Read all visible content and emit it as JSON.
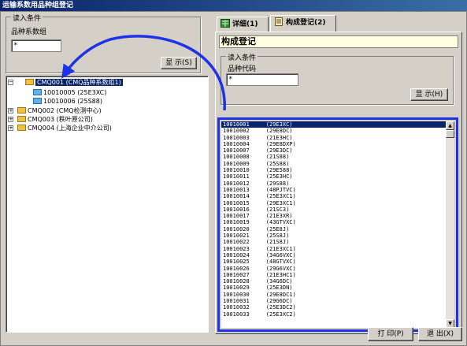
{
  "window": {
    "title": "运输系数用品种组登记"
  },
  "left": {
    "group_title": "读入条件",
    "field_label": "品种系数组",
    "field_value": "*",
    "show_button": "显 示(S)",
    "tree": [
      {
        "code": "CMQ001",
        "name": "(CMQ品种系数组1)",
        "selected": true,
        "expanded": true,
        "children": [
          {
            "code": "10010005",
            "name": "(25E3XC)"
          },
          {
            "code": "10010006",
            "name": "(25S88)"
          }
        ]
      },
      {
        "code": "CMQ002",
        "name": "(CMQ检测中心)"
      },
      {
        "code": "CMQ003",
        "name": "(秩叶原公司)"
      },
      {
        "code": "CMQ004",
        "name": "(上海企业中介公司)"
      }
    ]
  },
  "tabs": [
    {
      "label": "详细(1)",
      "icon": "book-icon"
    },
    {
      "label": "构成登记(2)",
      "icon": "notepad-icon"
    }
  ],
  "right": {
    "section_title": "构成登记",
    "group_title": "读入条件",
    "field_label": "品种代码",
    "field_value": "*",
    "show_button": "显 示(H)",
    "list": [
      {
        "code": "10010001",
        "name": "(29E3XC)"
      },
      {
        "code": "10010002",
        "name": "(29E8DC)"
      },
      {
        "code": "10010003",
        "name": "(21E3HC)"
      },
      {
        "code": "10010004",
        "name": "(29E8DXP)"
      },
      {
        "code": "10010007",
        "name": "(29E3DC)"
      },
      {
        "code": "10010008",
        "name": "(21S88)"
      },
      {
        "code": "10010009",
        "name": "(25S88)"
      },
      {
        "code": "10010010",
        "name": "(29E588)"
      },
      {
        "code": "10010011",
        "name": "(25E3HC)"
      },
      {
        "code": "10010012",
        "name": "(29S88)"
      },
      {
        "code": "10010013",
        "name": "(48PJTVC)"
      },
      {
        "code": "10010014",
        "name": "(25E3XC1)"
      },
      {
        "code": "10010015",
        "name": "(29E3XC1)"
      },
      {
        "code": "10010016",
        "name": "(21SC3)"
      },
      {
        "code": "10010017",
        "name": "(21E3XR)"
      },
      {
        "code": "10010019",
        "name": "(43GTVXC)"
      },
      {
        "code": "10010020",
        "name": "(25E8J)"
      },
      {
        "code": "10010021",
        "name": "(25S8J)"
      },
      {
        "code": "10010022",
        "name": "(21S8J)"
      },
      {
        "code": "10010023",
        "name": "(21E3XC1)"
      },
      {
        "code": "10010024",
        "name": "(34G6VXC)"
      },
      {
        "code": "10010025",
        "name": "(48GTVXC)"
      },
      {
        "code": "10010026",
        "name": "(29G6VXC)"
      },
      {
        "code": "10010027",
        "name": "(21E3HC1)"
      },
      {
        "code": "10010028",
        "name": "(34G6DC)"
      },
      {
        "code": "10010029",
        "name": "(25E3DN)"
      },
      {
        "code": "10010030",
        "name": "(29E8DC1)"
      },
      {
        "code": "10010031",
        "name": "(29G6DC)"
      },
      {
        "code": "10010032",
        "name": "(25E3DC2)"
      },
      {
        "code": "10010033",
        "name": "(25E3XC2)"
      }
    ]
  },
  "footer": {
    "print_button": "打 印(P)",
    "exit_button": "退 出(X)"
  },
  "colors": {
    "title_bar": "#0a246a",
    "highlight": "#1e32e6",
    "selection": "#0a246a",
    "section_bg": "#ffffe0"
  }
}
